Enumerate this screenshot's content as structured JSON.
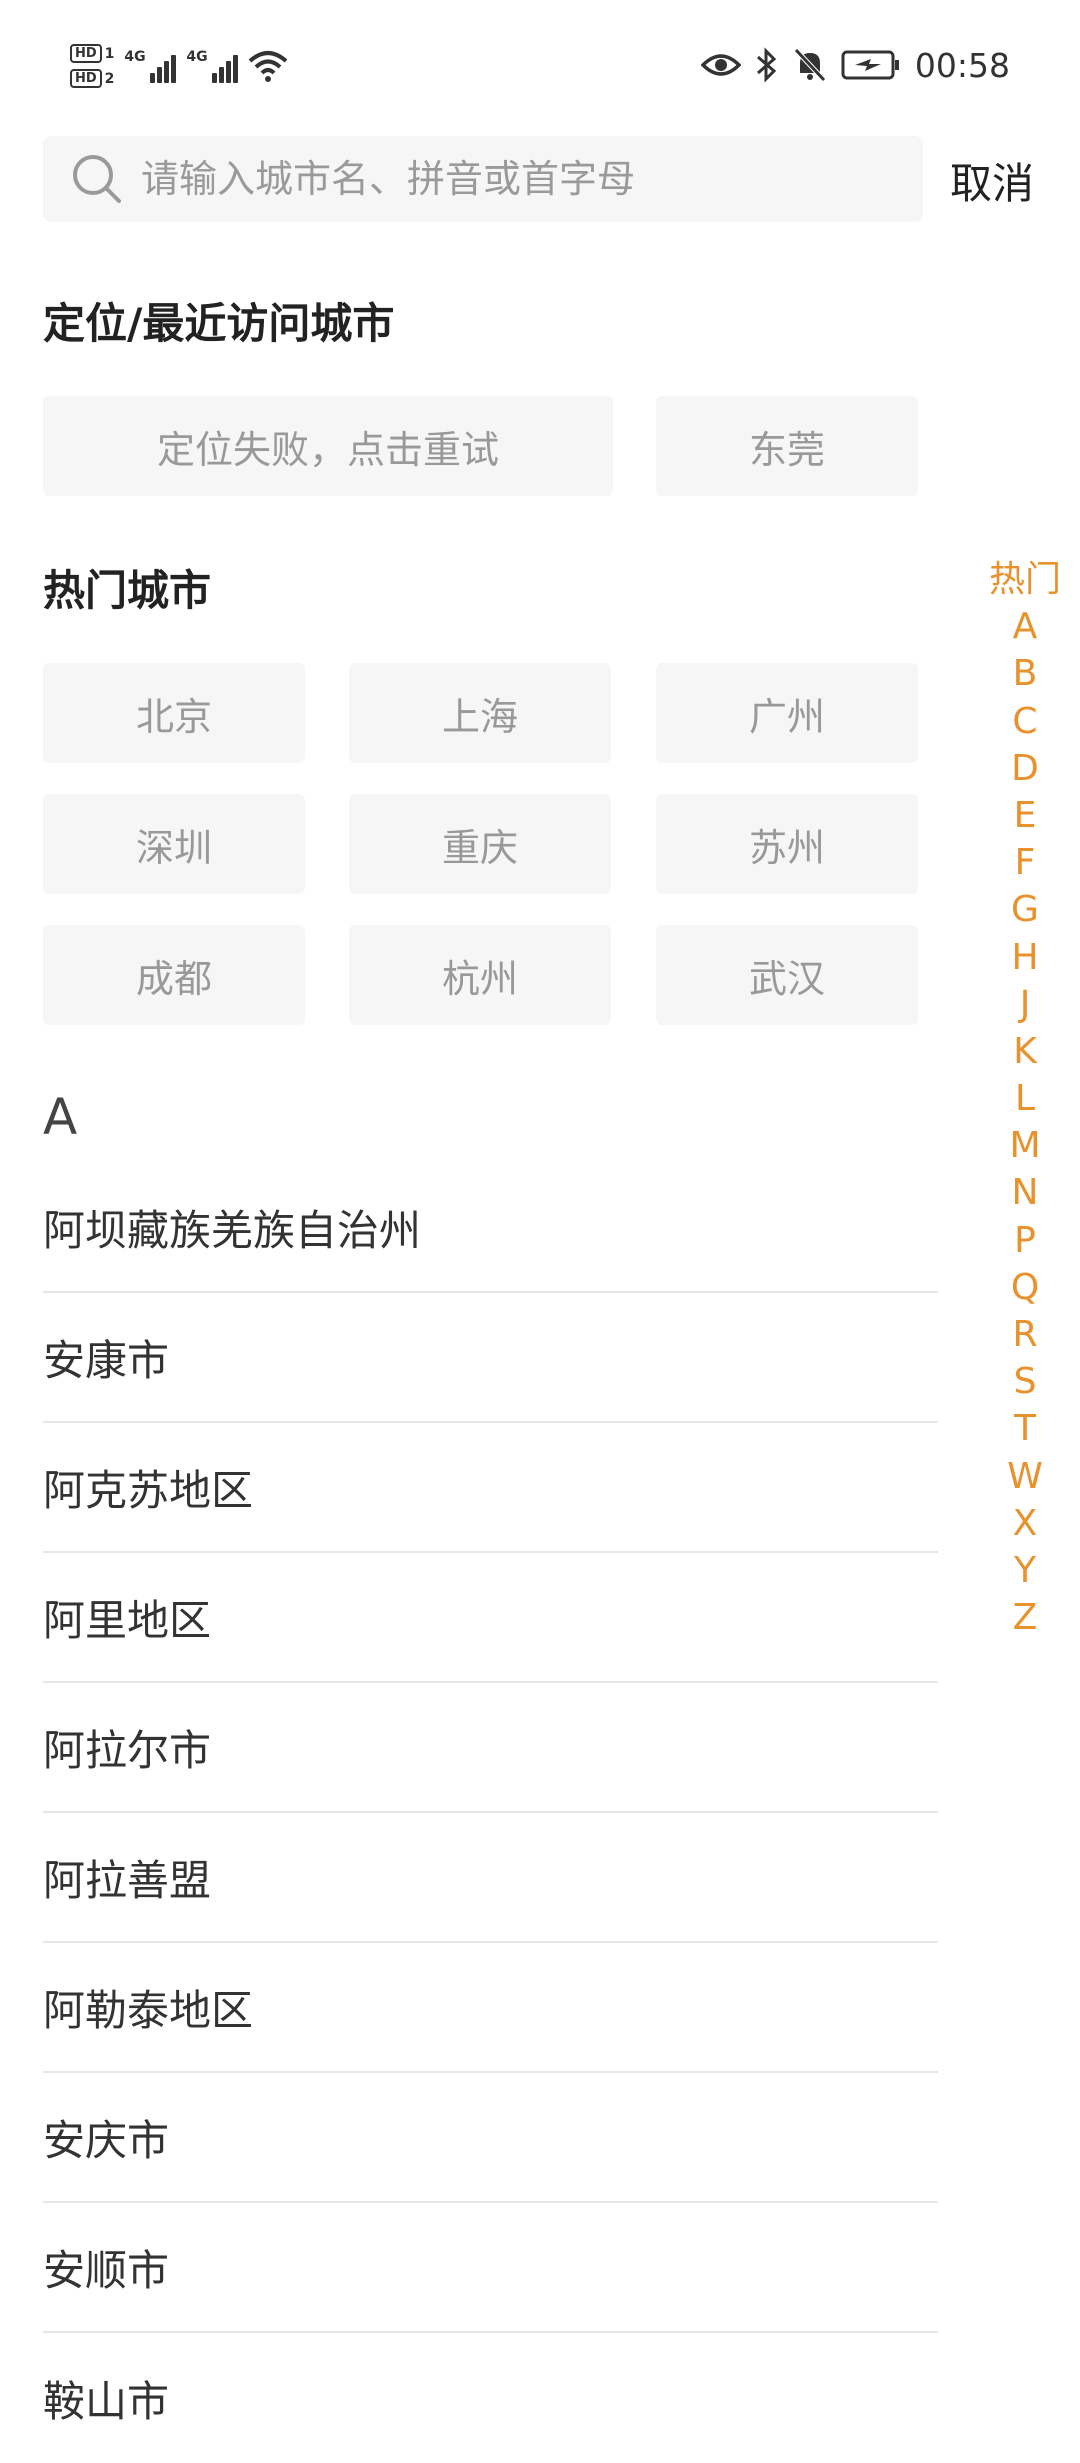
{
  "status_bar": {
    "hd1": "HD",
    "hd1_sub": "1",
    "hd2": "HD",
    "hd2_sub": "2",
    "net1": "4G",
    "net2": "4G",
    "time": "00:58"
  },
  "search": {
    "placeholder": "请输入城市名、拼音或首字母",
    "value": "",
    "cancel_label": "取消"
  },
  "location_section": {
    "title": "定位/最近访问城市",
    "locate_label": "定位失败，点击重试",
    "recent": [
      "东莞"
    ]
  },
  "hot_section": {
    "title": "热门城市",
    "cities": [
      "北京",
      "上海",
      "广州",
      "深圳",
      "重庆",
      "苏州",
      "成都",
      "杭州",
      "武汉"
    ]
  },
  "city_list": {
    "letter": "A",
    "cities": [
      "阿坝藏族羌族自治州",
      "安康市",
      "阿克苏地区",
      "阿里地区",
      "阿拉尔市",
      "阿拉善盟",
      "阿勒泰地区",
      "安庆市",
      "安顺市",
      "鞍山市"
    ]
  },
  "index_bar": {
    "items": [
      "热门",
      "A",
      "B",
      "C",
      "D",
      "E",
      "F",
      "G",
      "H",
      "J",
      "K",
      "L",
      "M",
      "N",
      "P",
      "Q",
      "R",
      "S",
      "T",
      "W",
      "X",
      "Y",
      "Z"
    ]
  },
  "colors": {
    "accent": "#e8922e",
    "chip_bg": "#f6f6f6",
    "chip_text": "#999999",
    "divider": "#e6e6e6"
  }
}
